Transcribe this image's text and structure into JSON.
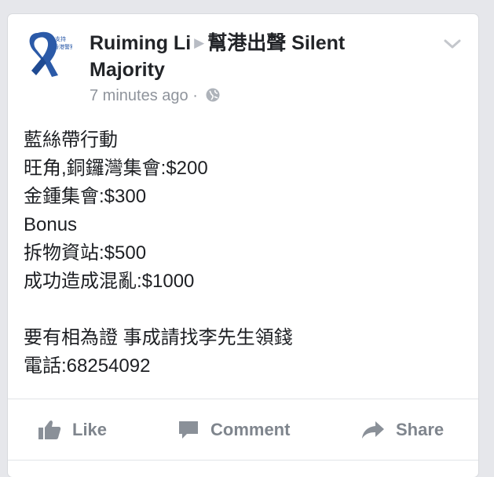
{
  "post": {
    "author": "Ruiming Li",
    "page_name_line1": "幫港出聲 Silent",
    "page_name_line2": "Majority",
    "timestamp": "7 minutes ago",
    "separator": "·",
    "avatar_text_line1": "支持",
    "avatar_text_line2": "香港警察",
    "icons": {
      "avatar": "blue-ribbon-icon",
      "arrow": "right-triangle-icon",
      "audience": "globe-icon",
      "menu": "chevron-down-icon"
    },
    "body_lines": [
      "藍絲帶行動",
      "旺角,銅鑼灣集會:$200",
      "金鍾集會:$300",
      "Bonus",
      "拆物資站:$500",
      "成功造成混亂:$1000",
      "",
      "要有相為證 事成請找李先生領錢",
      "電話:68254092"
    ]
  },
  "actions": {
    "like_label": "Like",
    "comment_label": "Comment",
    "share_label": "Share"
  },
  "colors": {
    "ribbon": "#2b5aa8",
    "action_text": "#7f858d",
    "meta_text": "#8f949c"
  }
}
